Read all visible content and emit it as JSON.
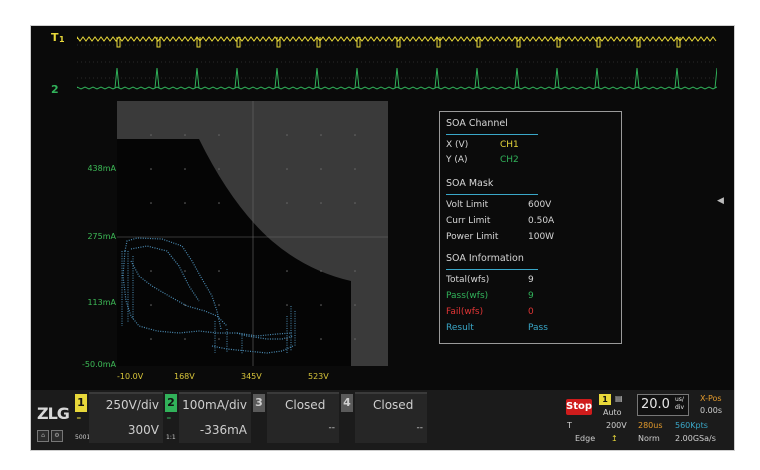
{
  "colors": {
    "ch1": "#e8d83a",
    "ch2": "#31b25a",
    "pass": "#31b25a",
    "fail": "#e03535",
    "result": "#3aa7c8",
    "stop": "#cf1c1c"
  },
  "markers": {
    "trigger": "T",
    "ch1": "1",
    "ch2": "2"
  },
  "plot": {
    "y_labels": [
      "438mA",
      "275mA",
      "113mA",
      "-50.0mA"
    ],
    "x_labels": [
      "-10.0V",
      "168V",
      "345V",
      "523V"
    ]
  },
  "soa_panel": {
    "channel_title": "SOA Channel",
    "x_label": "X (V)",
    "x_value": "CH1",
    "y_label": "Y (A)",
    "y_value": "CH2",
    "mask_title": "SOA Mask",
    "volt_label": "Volt Limit",
    "volt_value": "600V",
    "curr_label": "Curr Limit",
    "curr_value": "0.50A",
    "power_label": "Power Limit",
    "power_value": "100W",
    "info_title": "SOA Information",
    "total_label": "Total(wfs)",
    "total_value": "9",
    "pass_label": "Pass(wfs)",
    "pass_value": "9",
    "fail_label": "Fail(wfs)",
    "fail_value": "0",
    "result_label": "Result",
    "result_value": "Pass"
  },
  "bottom_bar": {
    "logo": "ZLG",
    "logo_sub": "5001",
    "ch1": {
      "number": "1",
      "scale": "250V/div",
      "offset": "300V"
    },
    "ch2": {
      "number": "2",
      "scale": "100mA/div",
      "offset": "-336mA",
      "sub": "1:1"
    },
    "ch3": {
      "number": "3",
      "status": "Closed",
      "offset": "--"
    },
    "ch4": {
      "number": "4",
      "status": "Closed",
      "offset": "--"
    },
    "stop_label": "Stop",
    "trig_mode": "Auto",
    "trig_source": "1",
    "trig_level_label": "T",
    "trig_level": "200V",
    "trig_type": "Edge",
    "timebase": "20.0",
    "timebase_unit_top": "us/",
    "timebase_unit_bot": "div",
    "time_offset": "280us",
    "mode": "Norm",
    "xpos_label": "X-Pos",
    "xpos_value": "0.00s",
    "mem_depth": "560Kpts",
    "sample_rate": "2.00GSa/s"
  }
}
